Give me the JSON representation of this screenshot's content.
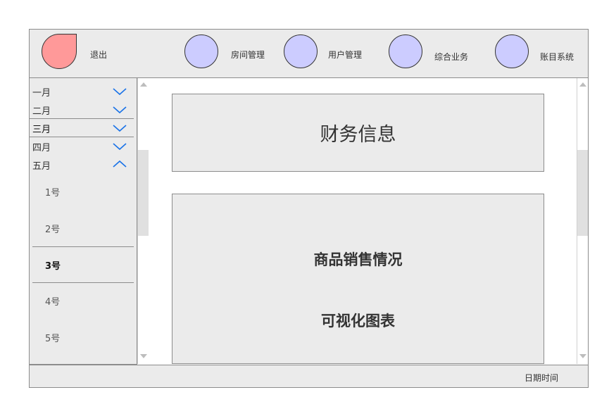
{
  "header": {
    "logout_label": "退出",
    "nav": [
      {
        "label": "房间管理"
      },
      {
        "label": "用户管理"
      },
      {
        "label": "综合业务"
      },
      {
        "label": "账目系统"
      }
    ]
  },
  "sidebar": {
    "months": [
      {
        "label": "一月",
        "expanded": false
      },
      {
        "label": "二月",
        "expanded": false
      },
      {
        "label": "三月",
        "expanded": false
      },
      {
        "label": "四月",
        "expanded": false
      },
      {
        "label": "五月",
        "expanded": true
      }
    ],
    "days": [
      {
        "label": "1号",
        "selected": false
      },
      {
        "label": "2号",
        "selected": false
      },
      {
        "label": "3号",
        "selected": true
      },
      {
        "label": "4号",
        "selected": false
      },
      {
        "label": "5号",
        "selected": false
      }
    ]
  },
  "main": {
    "finance_title": "财务信息",
    "chart_panel": {
      "line1": "商品销售情况",
      "line2": "可视化图表"
    }
  },
  "status": {
    "datetime_label": "日期时间"
  },
  "colors": {
    "logout": "#ff9999",
    "nav_circle": "#ccccff",
    "chevron": "#1a73e8",
    "panel_bg": "#ebebeb"
  }
}
